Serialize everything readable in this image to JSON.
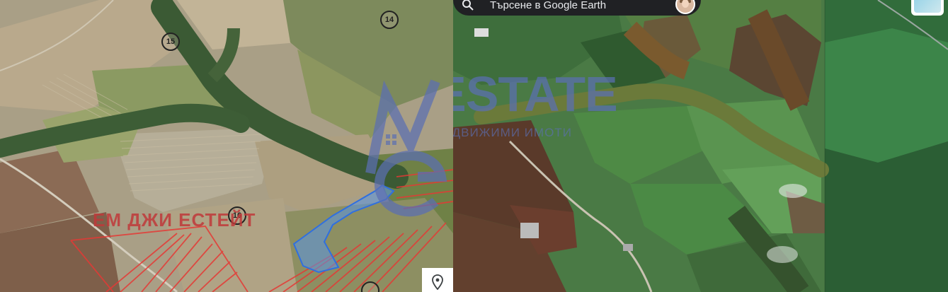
{
  "search": {
    "placeholder": "Търсене в Google Earth"
  },
  "watermark": {
    "agency_name": "ЕМ ДЖИ ЕСТЕЙТ",
    "logo_text": "ESTATE",
    "logo_subtitle": "НЕДВИЖИМИ ИМОТИ"
  },
  "parcel_labels": [
    "15",
    "14",
    "16"
  ],
  "icons": {
    "search": "search-icon",
    "avatar": "user-avatar",
    "layers": "map-layers-icon",
    "pin": "location-pin-icon"
  },
  "colors": {
    "watermark_red": "#c0393a",
    "logo_blue": "#5b6fb3",
    "highlighted_plot": "#4f8fe0",
    "cadastre_lines": "#e53935",
    "search_bar": "#202124"
  }
}
